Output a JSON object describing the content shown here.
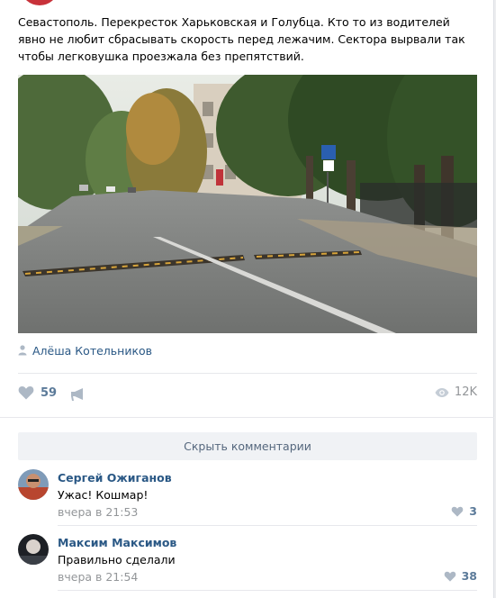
{
  "post": {
    "text": "Севастополь. Перекресток Харьковская и Голубца. Кто то из водителей явно не любит сбрасывать скорость перед лежачим. Сектора вырвали так чтобы легковушка проезжала без препятствий.",
    "signer": "Алёша Котельников",
    "likes": "59",
    "views": "12K",
    "photo_alt": "intersection-road-photo"
  },
  "comments_toggle": "Скрыть комментарии",
  "comments": [
    {
      "author": "Сергей Ожиганов",
      "text": "Ужас! Кошмар!",
      "date": "вчера в 21:53",
      "likes": "3"
    },
    {
      "author": "Максим Максимов",
      "text": "Правильно сделали",
      "date": "вчера в 21:54",
      "likes": "38"
    }
  ],
  "colors": {
    "link": "#2a5885",
    "muted": "#939699",
    "like": "#5b7a99",
    "icon": "#adb8c5"
  },
  "icons": [
    "user-icon",
    "heart-icon",
    "megaphone-icon",
    "eye-icon"
  ]
}
